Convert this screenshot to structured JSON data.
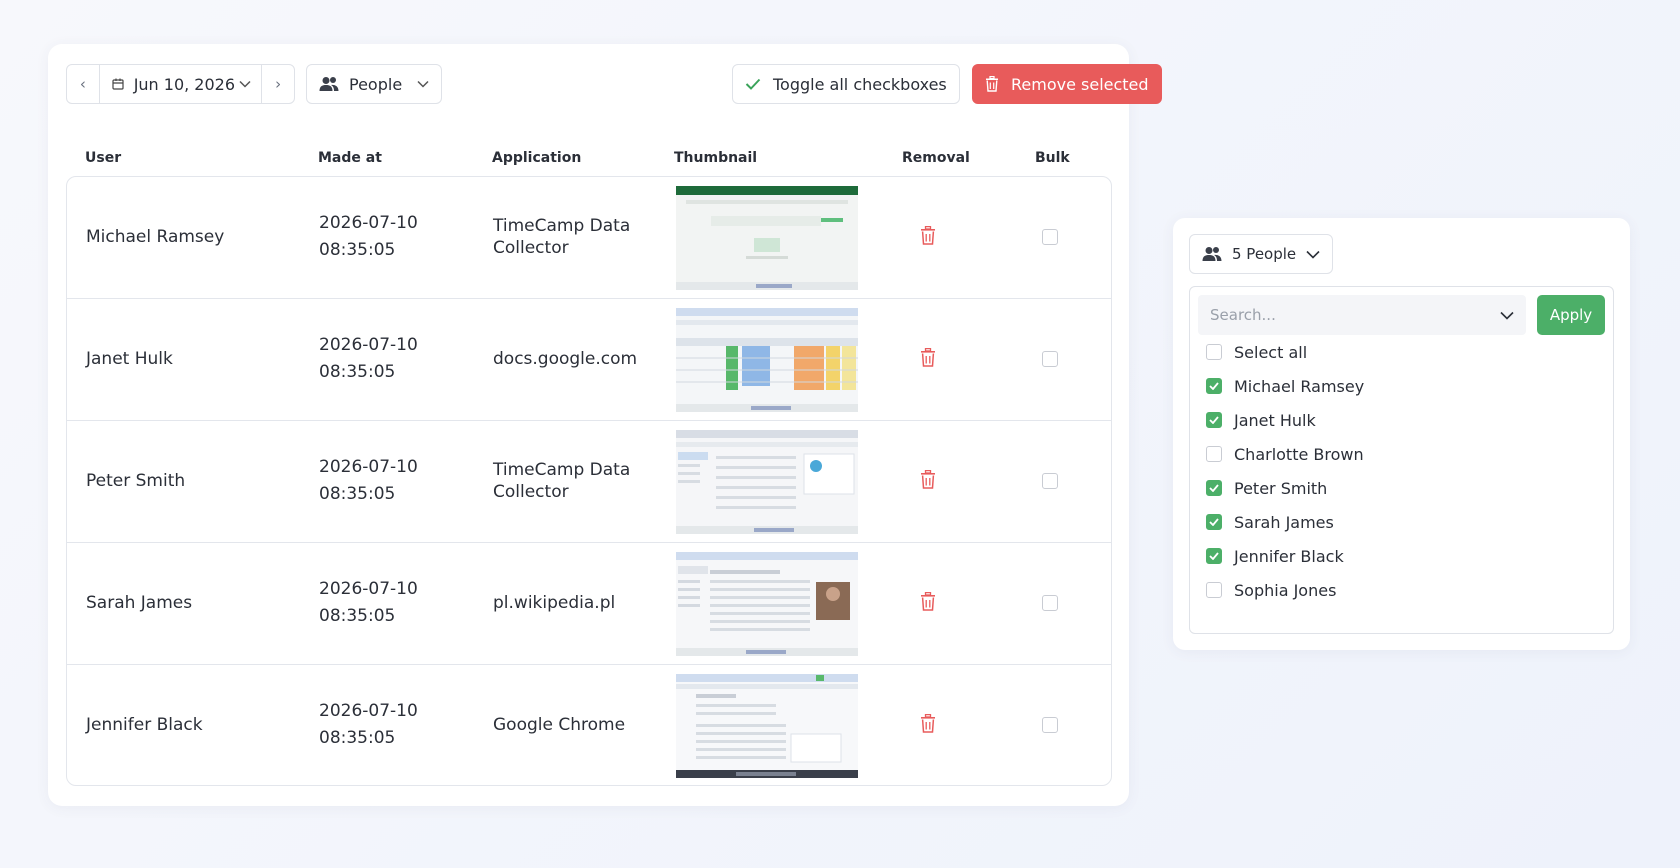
{
  "toolbar": {
    "date": "Jun 10, 2026",
    "people_label": "People",
    "toggle_label": "Toggle all checkboxes",
    "remove_label": "Remove selected"
  },
  "table": {
    "headers": [
      "User",
      "Made at",
      "Application",
      "Thumbnail",
      "Removal",
      "Bulk"
    ],
    "rows": [
      {
        "user": "Michael Ramsey",
        "date": "2026-07-10",
        "time": "08:35:05",
        "app": "TimeCamp Data Collector",
        "thumb": "spreadsheet",
        "bulk": false
      },
      {
        "user": "Janet Hulk",
        "date": "2026-07-10",
        "time": "08:35:05",
        "app": "docs.google.com",
        "thumb": "sheet",
        "bulk": false
      },
      {
        "user": "Peter Smith",
        "date": "2026-07-10",
        "time": "08:35:05",
        "app": "TimeCamp Data Collector",
        "thumb": "mail",
        "bulk": false
      },
      {
        "user": "Sarah James",
        "date": "2026-07-10",
        "time": "08:35:05",
        "app": "pl.wikipedia.pl",
        "thumb": "wiki",
        "bulk": false
      },
      {
        "user": "Jennifer Black",
        "date": "2026-07-10",
        "time": "08:35:05",
        "app": "Google Chrome",
        "thumb": "web",
        "bulk": false
      }
    ]
  },
  "filter_panel": {
    "button_label": "5 People",
    "search_placeholder": "Search...",
    "apply_label": "Apply",
    "options": [
      {
        "label": "Select all",
        "checked": false
      },
      {
        "label": "Michael Ramsey",
        "checked": true
      },
      {
        "label": "Janet Hulk",
        "checked": true
      },
      {
        "label": "Charlotte Brown",
        "checked": false
      },
      {
        "label": "Peter Smith",
        "checked": true
      },
      {
        "label": "Sarah James",
        "checked": true
      },
      {
        "label": "Jennifer Black",
        "checked": true
      },
      {
        "label": "Sophia Jones",
        "checked": false
      }
    ]
  },
  "colors": {
    "accent_green": "#4caf68",
    "danger_red": "#e85b5b",
    "trash_red": "#e85b5b"
  }
}
